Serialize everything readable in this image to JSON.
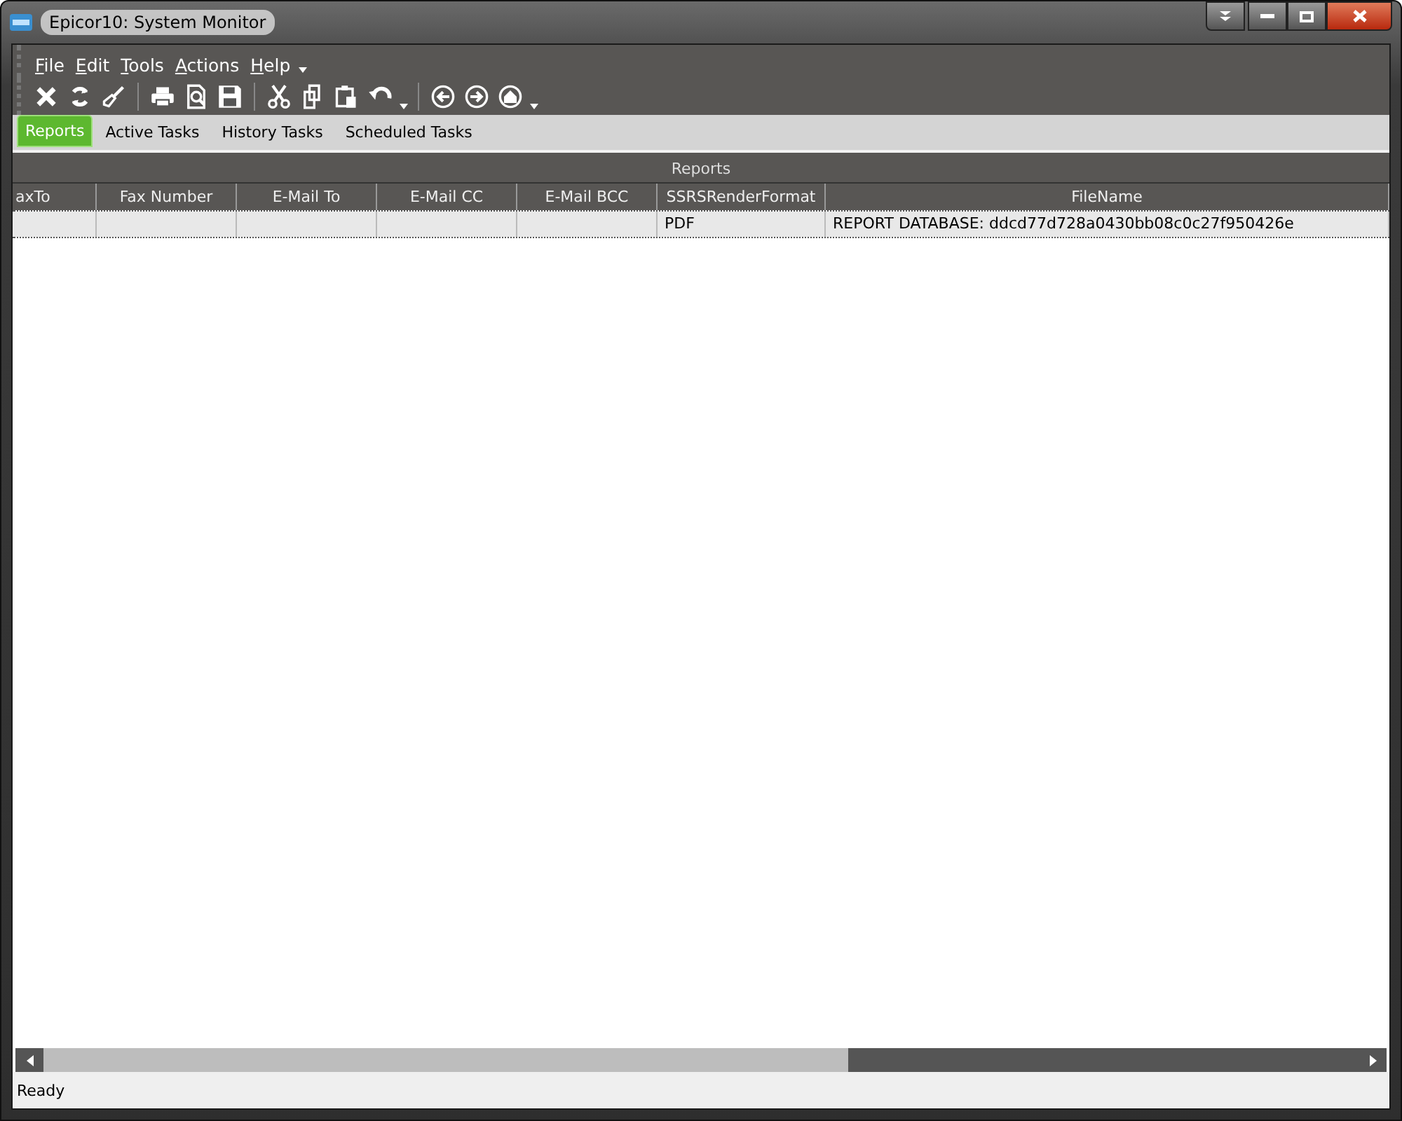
{
  "window": {
    "title": "Epicor10: System Monitor"
  },
  "menu": [
    "File",
    "Edit",
    "Tools",
    "Actions",
    "Help"
  ],
  "tabs": [
    {
      "label": "Reports",
      "selected": true
    },
    {
      "label": "Active Tasks",
      "selected": false
    },
    {
      "label": "History Tasks",
      "selected": false
    },
    {
      "label": "Scheduled Tasks",
      "selected": false
    }
  ],
  "grid": {
    "title": "Reports",
    "columns": [
      "axTo",
      "Fax Number",
      "E-Mail To",
      "E-Mail CC",
      "E-Mail BCC",
      "SSRSRenderFormat",
      "FileName"
    ],
    "rows": [
      {
        "selected": true,
        "cells": [
          "",
          "",
          "",
          "",
          "",
          "PDF",
          "REPORT DATABASE: ddcd77d728a0430bb08c0c27f950426e"
        ]
      }
    ]
  },
  "status_bar": "Ready"
}
